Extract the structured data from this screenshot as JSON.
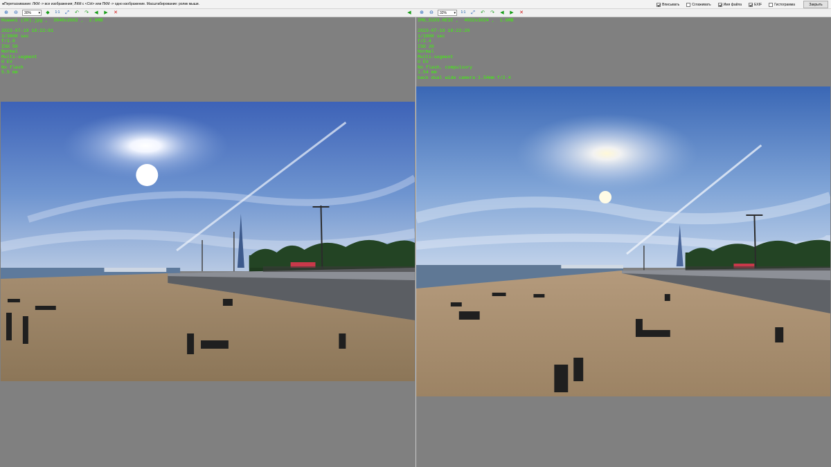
{
  "hint": "●Перетаскивание: ЛКМ -> все изображения; ЛКМ с <Ctrl> или ПКМ -> одно изображение. Масштабирование: ролик мыши.",
  "options": [
    {
      "label": "Вписывать",
      "checked": true
    },
    {
      "label": "Сглаживать",
      "checked": false
    },
    {
      "label": "Имя файла",
      "checked": true
    },
    {
      "label": "EXIF",
      "checked": true
    },
    {
      "label": "Гистограмма",
      "checked": false
    }
  ],
  "close_label": "Закрыть",
  "left": {
    "zoom": "30%",
    "one_to_one": "1:1",
    "info": {
      "file": "Huawei (30).jpg ,  3648x2682 ,  2.6MB",
      "datetime": "2023-07-19 18:22:01",
      "exposure": "1/3800 sec",
      "aperture": "f/1.8",
      "iso": "ISO 50",
      "mode1": "Normal",
      "metering": "Multi-segment",
      "ev": "0 EV",
      "flash": "No flash",
      "focal": "5.5 mm"
    }
  },
  "right": {
    "zoom": "32%",
    "one_to_one": "1:1",
    "info": {
      "file": "IMG_5103.HEIC ,  4032x3024 ,  1.6MB",
      "datetime": "2023-07-19 18:22:20",
      "exposure": "1/1800 sec",
      "aperture": "f/2.4",
      "iso": "ISO 20",
      "mode1": "Normal",
      "metering": "Multi-segment",
      "ev": "0 EV",
      "flash": "No flash, compulsory",
      "focal": "1.54 mm",
      "lens": "back dual wide camera 1.54mm f/2.4"
    }
  },
  "colors": {
    "info_text": "#39ff00",
    "panel_bg": "#808080",
    "sky_top": "#3f64b8",
    "sand": "#b59a77"
  }
}
